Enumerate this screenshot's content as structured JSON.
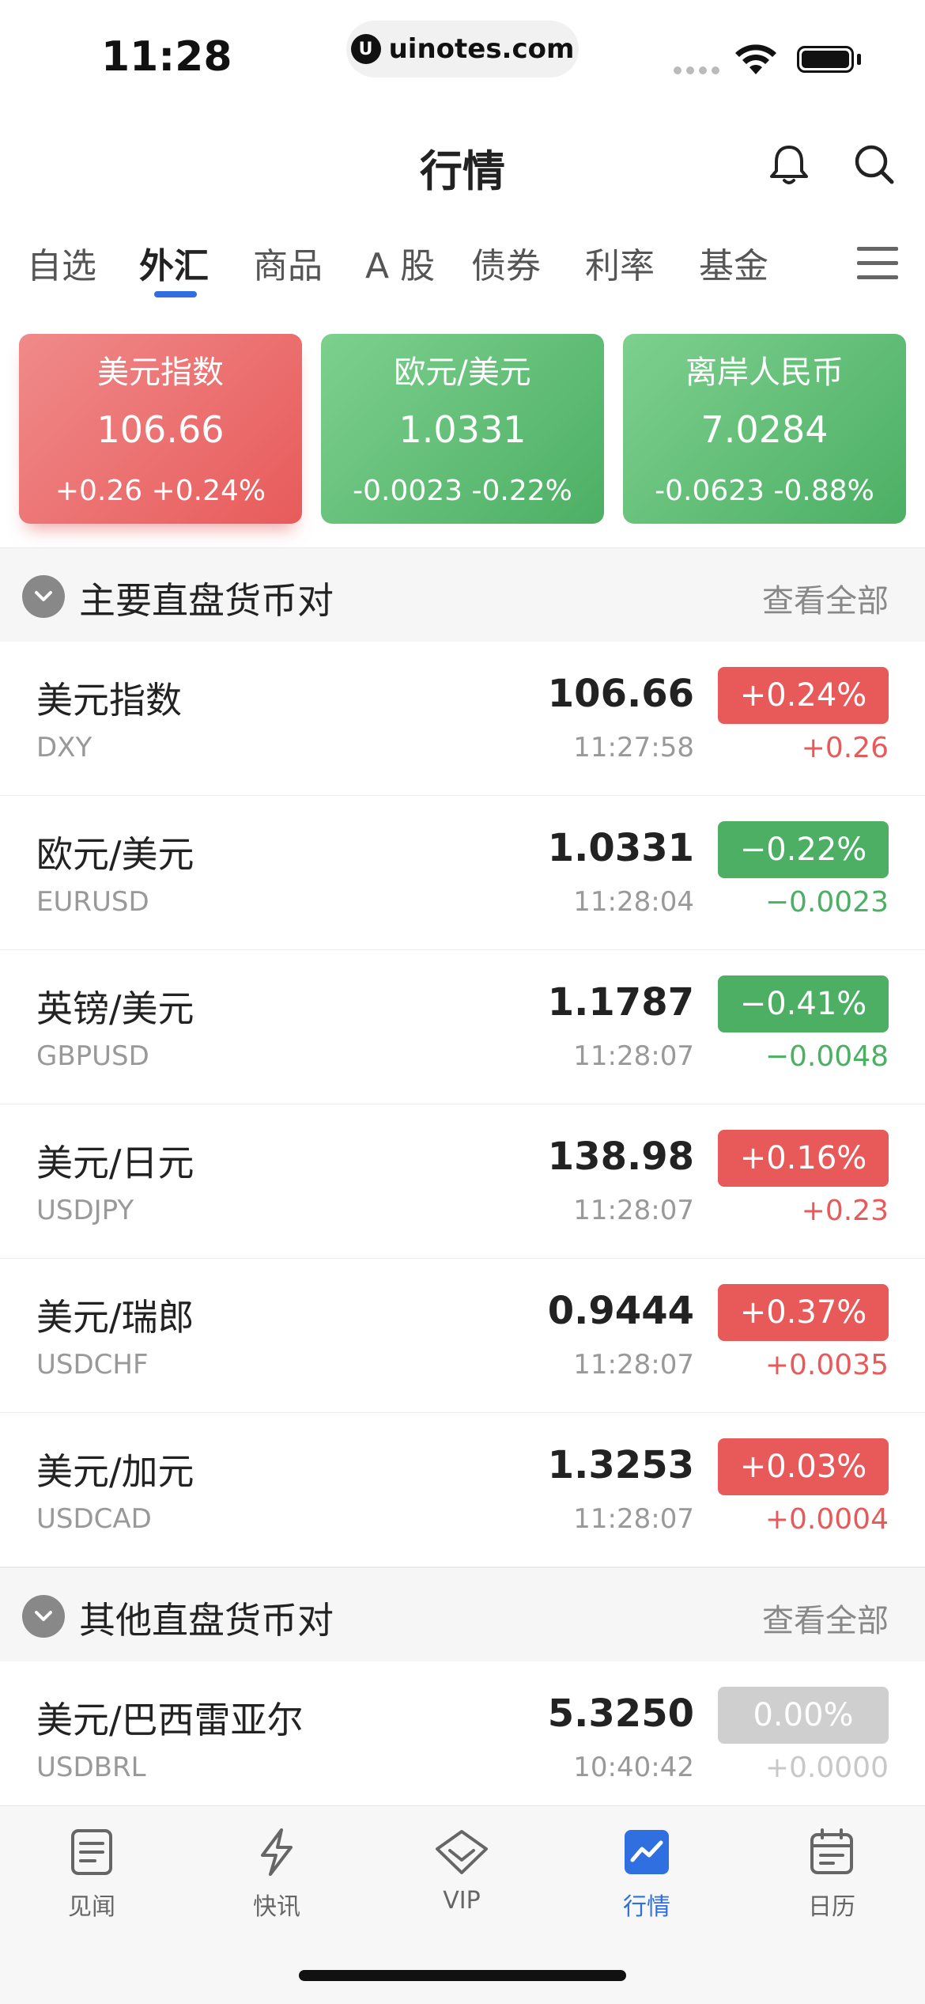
{
  "status_bar": {
    "time": "11:28",
    "url": "uinotes.com",
    "url_logo": "U"
  },
  "header": {
    "title": "行情"
  },
  "tabs": [
    "自选",
    "外汇",
    "商品",
    "A 股",
    "债券",
    "利率",
    "基金"
  ],
  "active_tab": "外汇",
  "cards": [
    {
      "name": "美元指数",
      "value": "106.66",
      "change": "+0.26 +0.24%",
      "trend": "up"
    },
    {
      "name": "欧元/美元",
      "value": "1.0331",
      "change": "-0.0023 -0.22%",
      "trend": "down"
    },
    {
      "name": "离岸人民币",
      "value": "7.0284",
      "change": "-0.0623 -0.88%",
      "trend": "down"
    }
  ],
  "sections": [
    {
      "title": "主要直盘货币对",
      "link": "查看全部",
      "rows": [
        {
          "name": "美元指数",
          "code": "DXY",
          "price": "106.66",
          "time": "11:27:58",
          "pct": "+0.24%",
          "chg": "+0.26",
          "trend": "up"
        },
        {
          "name": "欧元/美元",
          "code": "EURUSD",
          "price": "1.0331",
          "time": "11:28:04",
          "pct": "−0.22%",
          "chg": "−0.0023",
          "trend": "down"
        },
        {
          "name": "英镑/美元",
          "code": "GBPUSD",
          "price": "1.1787",
          "time": "11:28:07",
          "pct": "−0.41%",
          "chg": "−0.0048",
          "trend": "down"
        },
        {
          "name": "美元/日元",
          "code": "USDJPY",
          "price": "138.98",
          "time": "11:28:07",
          "pct": "+0.16%",
          "chg": "+0.23",
          "trend": "up"
        },
        {
          "name": "美元/瑞郎",
          "code": "USDCHF",
          "price": "0.9444",
          "time": "11:28:07",
          "pct": "+0.37%",
          "chg": "+0.0035",
          "trend": "up"
        },
        {
          "name": "美元/加元",
          "code": "USDCAD",
          "price": "1.3253",
          "time": "11:28:07",
          "pct": "+0.03%",
          "chg": "+0.0004",
          "trend": "up"
        }
      ]
    },
    {
      "title": "其他直盘货币对",
      "link": "查看全部",
      "rows": [
        {
          "name": "美元/巴西雷亚尔",
          "code": "USDBRL",
          "price": "5.3250",
          "time": "10:40:42",
          "pct": "0.00%",
          "chg": "+0.0000",
          "trend": "flat"
        }
      ]
    }
  ],
  "tabbar": [
    {
      "label": "见闻",
      "icon": "news-icon"
    },
    {
      "label": "快讯",
      "icon": "lightning-icon"
    },
    {
      "label": "VIP",
      "icon": "diamond-icon"
    },
    {
      "label": "行情",
      "icon": "chart-icon",
      "active": true
    },
    {
      "label": "日历",
      "icon": "calendar-icon"
    }
  ],
  "colors": {
    "up": "#e85a5a",
    "down": "#4caf64",
    "accent": "#2f6fe0",
    "flat": "#cfcfcf"
  }
}
